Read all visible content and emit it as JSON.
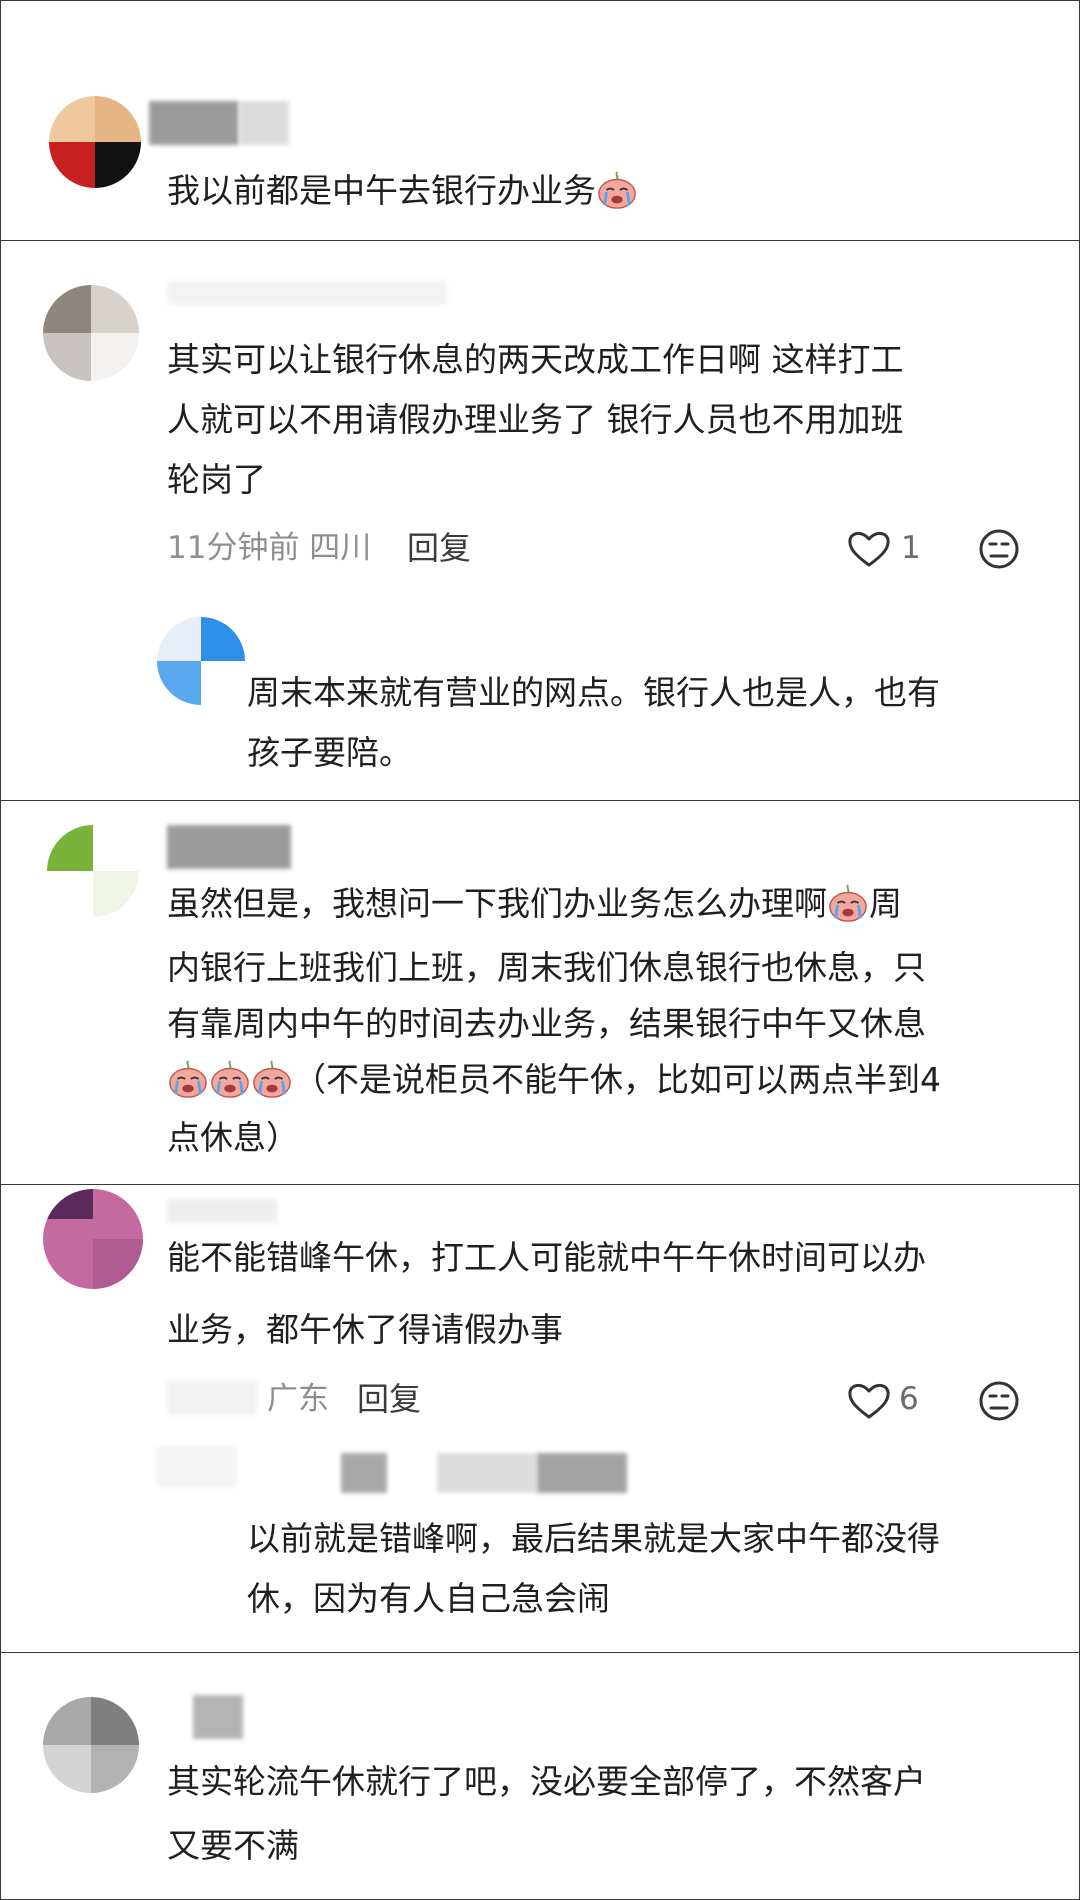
{
  "comments": [
    {
      "text": "我以前都是中午去银行办业务"
    },
    {
      "text_lines": [
        "其实可以让银行休息的两天改成工作日啊 这样打工",
        "人就可以不用请假办理业务了 银行人员也不用加班",
        "轮岗了"
      ],
      "meta": "11分钟前 四川",
      "reply_label": "回复",
      "likes": "1",
      "reply": {
        "text_lines": [
          "周末本来就有营业的网点。银行人也是人，也有",
          "孩子要陪。"
        ]
      }
    },
    {
      "text_lines": [
        "虽然但是，我想问一下我们办业务怎么办理啊",
        "周",
        "内银行上班我们上班，周末我们休息银行也休息，只",
        "有靠周内中午的时间去办业务，结果银行中午又休息",
        "（不是说柜员不能午休，比如可以两点半到4",
        "点休息）"
      ]
    },
    {
      "text_lines": [
        "能不能错峰午休，打工人可能就中午午休时间可以办",
        "业务，都午休了得请假办事"
      ],
      "meta": "广东",
      "reply_label": "回复",
      "likes": "6",
      "reply": {
        "text_lines": [
          "以前就是错峰啊，最后结果就是大家中午都没得",
          "休，因为有人自己急会闹"
        ]
      }
    },
    {
      "text_lines": [
        "其实轮流午休就行了吧，没必要全部停了，不然客户",
        "又要不满"
      ]
    }
  ],
  "icons": {
    "like": "heart-outline-icon",
    "dislike": "neutral-face-icon",
    "emoji": "crying-face-emoji"
  },
  "colors": {
    "border": "#3a3a3a",
    "text": "#1f1f1f",
    "meta": "#8f8f8f"
  }
}
